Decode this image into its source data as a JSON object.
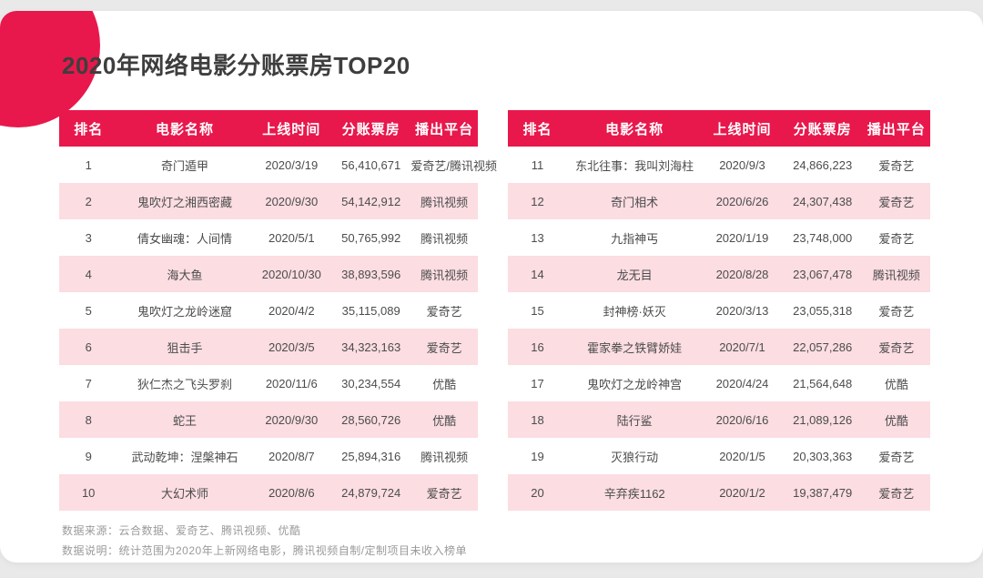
{
  "title": "2020年网络电影分账票房TOP20",
  "columns": [
    "排名",
    "电影名称",
    "上线时间",
    "分账票房",
    "播出平台"
  ],
  "tables": [
    {
      "name": "rank-1-10",
      "rows": [
        {
          "rank": "1",
          "movie": "奇门遁甲",
          "date": "2020/3/19",
          "revenue": "56,410,671",
          "platform": "爱奇艺/腾讯视频"
        },
        {
          "rank": "2",
          "movie": "鬼吹灯之湘西密藏",
          "date": "2020/9/30",
          "revenue": "54,142,912",
          "platform": "腾讯视频"
        },
        {
          "rank": "3",
          "movie": "倩女幽魂：人间情",
          "date": "2020/5/1",
          "revenue": "50,765,992",
          "platform": "腾讯视频"
        },
        {
          "rank": "4",
          "movie": "海大鱼",
          "date": "2020/10/30",
          "revenue": "38,893,596",
          "platform": "腾讯视频"
        },
        {
          "rank": "5",
          "movie": "鬼吹灯之龙岭迷窟",
          "date": "2020/4/2",
          "revenue": "35,115,089",
          "platform": "爱奇艺"
        },
        {
          "rank": "6",
          "movie": "狙击手",
          "date": "2020/3/5",
          "revenue": "34,323,163",
          "platform": "爱奇艺"
        },
        {
          "rank": "7",
          "movie": "狄仁杰之飞头罗刹",
          "date": "2020/11/6",
          "revenue": "30,234,554",
          "platform": "优酷"
        },
        {
          "rank": "8",
          "movie": "蛇王",
          "date": "2020/9/30",
          "revenue": "28,560,726",
          "platform": "优酷"
        },
        {
          "rank": "9",
          "movie": "武动乾坤：涅槃神石",
          "date": "2020/8/7",
          "revenue": "25,894,316",
          "platform": "腾讯视频"
        },
        {
          "rank": "10",
          "movie": "大幻术师",
          "date": "2020/8/6",
          "revenue": "24,879,724",
          "platform": "爱奇艺"
        }
      ]
    },
    {
      "name": "rank-11-20",
      "rows": [
        {
          "rank": "11",
          "movie": "东北往事：我叫刘海柱",
          "date": "2020/9/3",
          "revenue": "24,866,223",
          "platform": "爱奇艺"
        },
        {
          "rank": "12",
          "movie": "奇门相术",
          "date": "2020/6/26",
          "revenue": "24,307,438",
          "platform": "爱奇艺"
        },
        {
          "rank": "13",
          "movie": "九指神丐",
          "date": "2020/1/19",
          "revenue": "23,748,000",
          "platform": "爱奇艺"
        },
        {
          "rank": "14",
          "movie": "龙无目",
          "date": "2020/8/28",
          "revenue": "23,067,478",
          "platform": "腾讯视频"
        },
        {
          "rank": "15",
          "movie": "封神榜·妖灭",
          "date": "2020/3/13",
          "revenue": "23,055,318",
          "platform": "爱奇艺"
        },
        {
          "rank": "16",
          "movie": "霍家拳之铁臂娇娃",
          "date": "2020/7/1",
          "revenue": "22,057,286",
          "platform": "爱奇艺"
        },
        {
          "rank": "17",
          "movie": "鬼吹灯之龙岭神宫",
          "date": "2020/4/24",
          "revenue": "21,564,648",
          "platform": "优酷"
        },
        {
          "rank": "18",
          "movie": "陆行鲨",
          "date": "2020/6/16",
          "revenue": "21,089,126",
          "platform": "优酷"
        },
        {
          "rank": "19",
          "movie": "灭狼行动",
          "date": "2020/1/5",
          "revenue": "20,303,363",
          "platform": "爱奇艺"
        },
        {
          "rank": "20",
          "movie": "辛弃疾1162",
          "date": "2020/1/2",
          "revenue": "19,387,479",
          "platform": "爱奇艺"
        }
      ]
    }
  ],
  "notes": {
    "source": "数据来源：云合数据、爱奇艺、腾讯视频、优酷",
    "description": "数据说明：统计范围为2020年上新网络电影，腾讯视频自制/定制项目未收入榜单"
  },
  "colors": {
    "accent": "#e8184c",
    "row_alt": "#fbdde2",
    "page_bg": "#e9e9e9",
    "title_text": "#3e3e3e",
    "body_text": "#4c4c4c",
    "note_text": "#9a9a9a",
    "header_text": "#ffffff"
  }
}
